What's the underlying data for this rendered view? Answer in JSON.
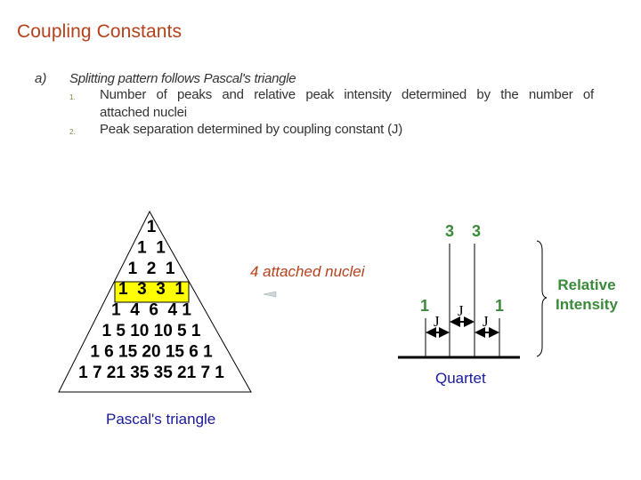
{
  "slide": {
    "title": "Coupling Constants",
    "section_label": "a)",
    "section_heading": "Splitting pattern follows Pascal's triangle",
    "items": [
      {
        "number": "1.",
        "text_line1": "Number of peaks and relative peak intensity determined by the number of",
        "text_line2": "attached nuclei"
      },
      {
        "number": "2.",
        "text_line1": "Peak separation determined by coupling constant (J)"
      }
    ]
  },
  "pascal_triangle": {
    "caption": "Pascal's triangle",
    "rows": [
      "1",
      "1  1",
      "1  2  1",
      "1  3  3  1",
      "1  4  6  4 1",
      "1 5 10 10 5 1",
      "1 6 15 20 15 6 1",
      "1 7 21 35 35 21 7 1"
    ],
    "highlighted_row_index": 3,
    "highlight_color": "#ffff00"
  },
  "annotation": {
    "nuclei_label": "4 attached nuclei"
  },
  "quartet_diagram": {
    "caption": "Quartet",
    "peak_intensities": [
      1,
      3,
      3,
      1
    ],
    "peak_labels": [
      "1",
      "3",
      "3",
      "1"
    ],
    "coupling_label": "J",
    "brace_label_line1": "Relative",
    "brace_label_line2": "Intensity"
  },
  "colors": {
    "title": "#b5411b",
    "peak_labels": "#3a8a3a",
    "captions": "#1a1a9a",
    "highlight": "#ffff00"
  }
}
